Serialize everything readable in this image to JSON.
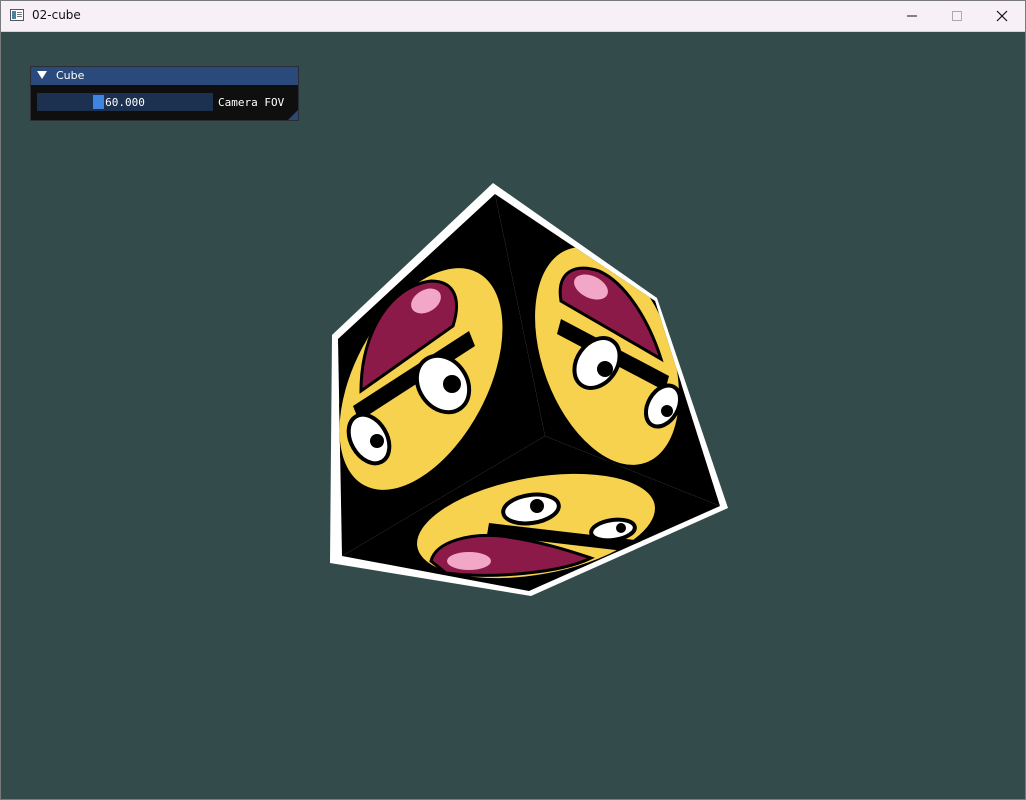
{
  "window": {
    "title": "02-cube",
    "icon": "app-window-icon",
    "controls": [
      "minimize-icon",
      "maximize-icon",
      "close-icon"
    ]
  },
  "imgui": {
    "panel_title": "Cube",
    "slider": {
      "label": "Camera FOV",
      "value_text": "60.000",
      "value": 60.0
    }
  },
  "scene": {
    "object": "textured-cube",
    "background_color": "#344b4b"
  },
  "colors": {
    "titlebar": "#f7f0f7",
    "panel_title": "#294a7a",
    "slider_bg": "#1c3150",
    "slider_grab": "#3d85e0",
    "face_yellow": "#f6d24e",
    "mouth": "#8b1a48",
    "tongue_pink": "#f2a7c7"
  }
}
